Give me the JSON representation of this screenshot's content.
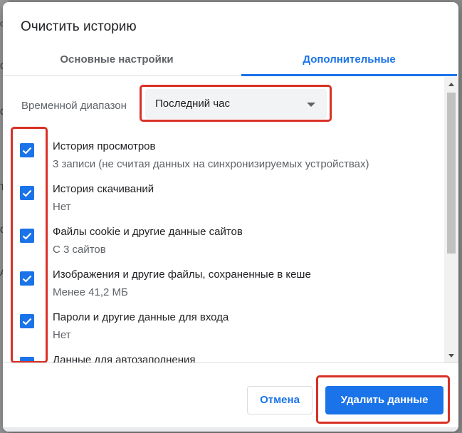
{
  "dialog": {
    "title": "Очистить историю"
  },
  "tabs": [
    {
      "label": "Основные настройки",
      "active": false
    },
    {
      "label": "Дополнительные",
      "active": true
    }
  ],
  "time_range": {
    "label": "Временной диапазон",
    "value": "Последний час"
  },
  "items": [
    {
      "title": "История просмотров",
      "subtitle": "3 записи (не считая данных на синхронизируемых устройствах)",
      "checked": true
    },
    {
      "title": "История скачиваний",
      "subtitle": "Нет",
      "checked": true
    },
    {
      "title": "Файлы cookie и другие данные сайтов",
      "subtitle": "С 3 сайтов",
      "checked": true
    },
    {
      "title": "Изображения и другие файлы, сохраненные в кеше",
      "subtitle": "Менее 41,2 МБ",
      "checked": true
    },
    {
      "title": "Пароли и другие данные для входа",
      "subtitle": "Нет",
      "checked": true
    },
    {
      "title": "Данные для автозаполнения",
      "subtitle": "",
      "checked": true
    }
  ],
  "buttons": {
    "cancel": "Отмена",
    "delete": "Удалить данные"
  },
  "colors": {
    "accent": "#1a73e8",
    "highlight": "#d93025",
    "muted_text": "#5f6368"
  },
  "background_fragments": [
    "о",
    "С",
    "С",
    "Т",
    "С",
    "А"
  ]
}
